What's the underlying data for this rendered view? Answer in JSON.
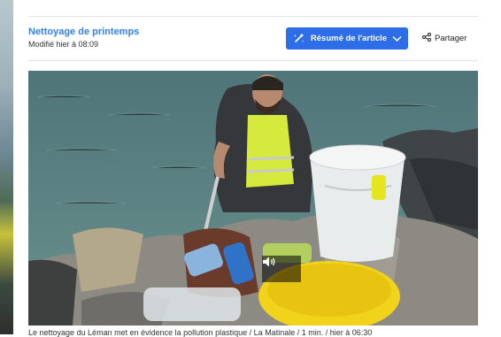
{
  "article": {
    "title": "Nettoyage de printemps",
    "modified": "Modifié hier à 08:09"
  },
  "toolbar": {
    "summary_label": "Résumé de l'article",
    "share_label": "Partager"
  },
  "media": {
    "caption": "Le nettoyage du Léman met en évidence la pollution plastique / La Matinale / 1 min. / hier à 06:30"
  },
  "colors": {
    "accent": "#2d6ee8",
    "title_link": "#2f7ff0"
  },
  "icons": {
    "summary": "sparkle-icon",
    "dropdown": "chevron-down-icon",
    "share": "share-icon",
    "sound": "speaker-icon"
  }
}
